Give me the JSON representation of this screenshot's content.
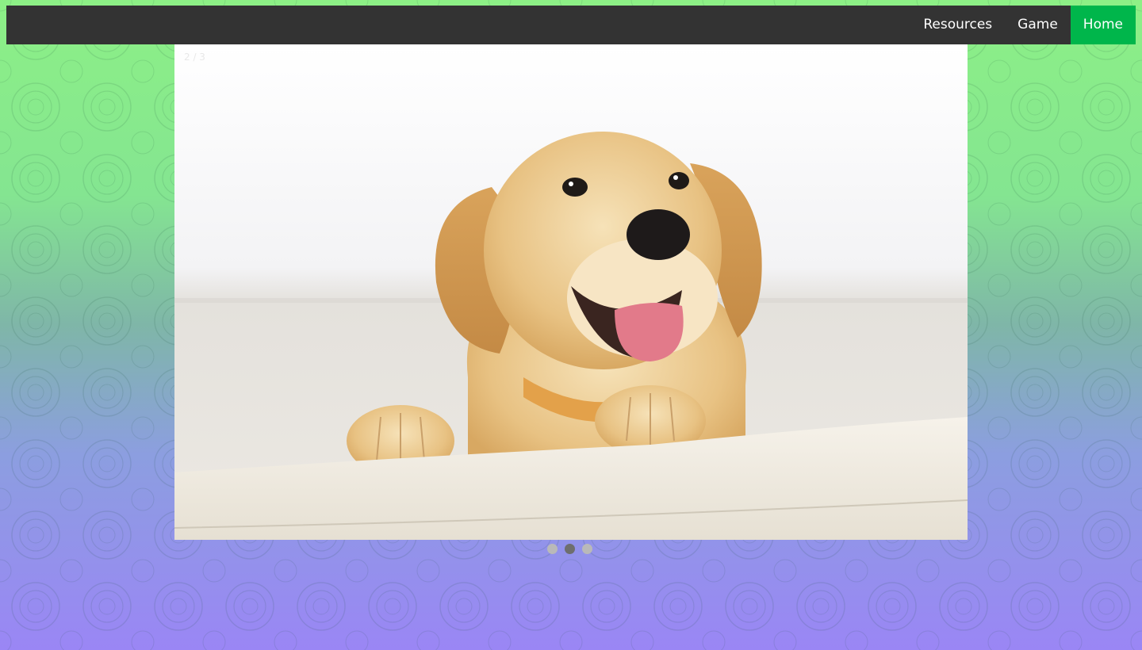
{
  "nav": {
    "items": [
      {
        "label": "Home",
        "active": true
      },
      {
        "label": "Game",
        "active": false
      },
      {
        "label": "Resources",
        "active": false
      }
    ],
    "active_color": "#00b64b",
    "bar_color": "#333333"
  },
  "slideshow": {
    "counter": "2 / 3",
    "current_slide": 2,
    "total_slides": 3,
    "image_subject": "golden retriever puppy resting paws on a white sofa"
  },
  "dots": [
    {
      "index": 1,
      "active": false
    },
    {
      "index": 2,
      "active": true
    },
    {
      "index": 3,
      "active": false
    }
  ],
  "colors": {
    "gradient_top": "#8df086",
    "gradient_bottom": "#9a86f5"
  }
}
